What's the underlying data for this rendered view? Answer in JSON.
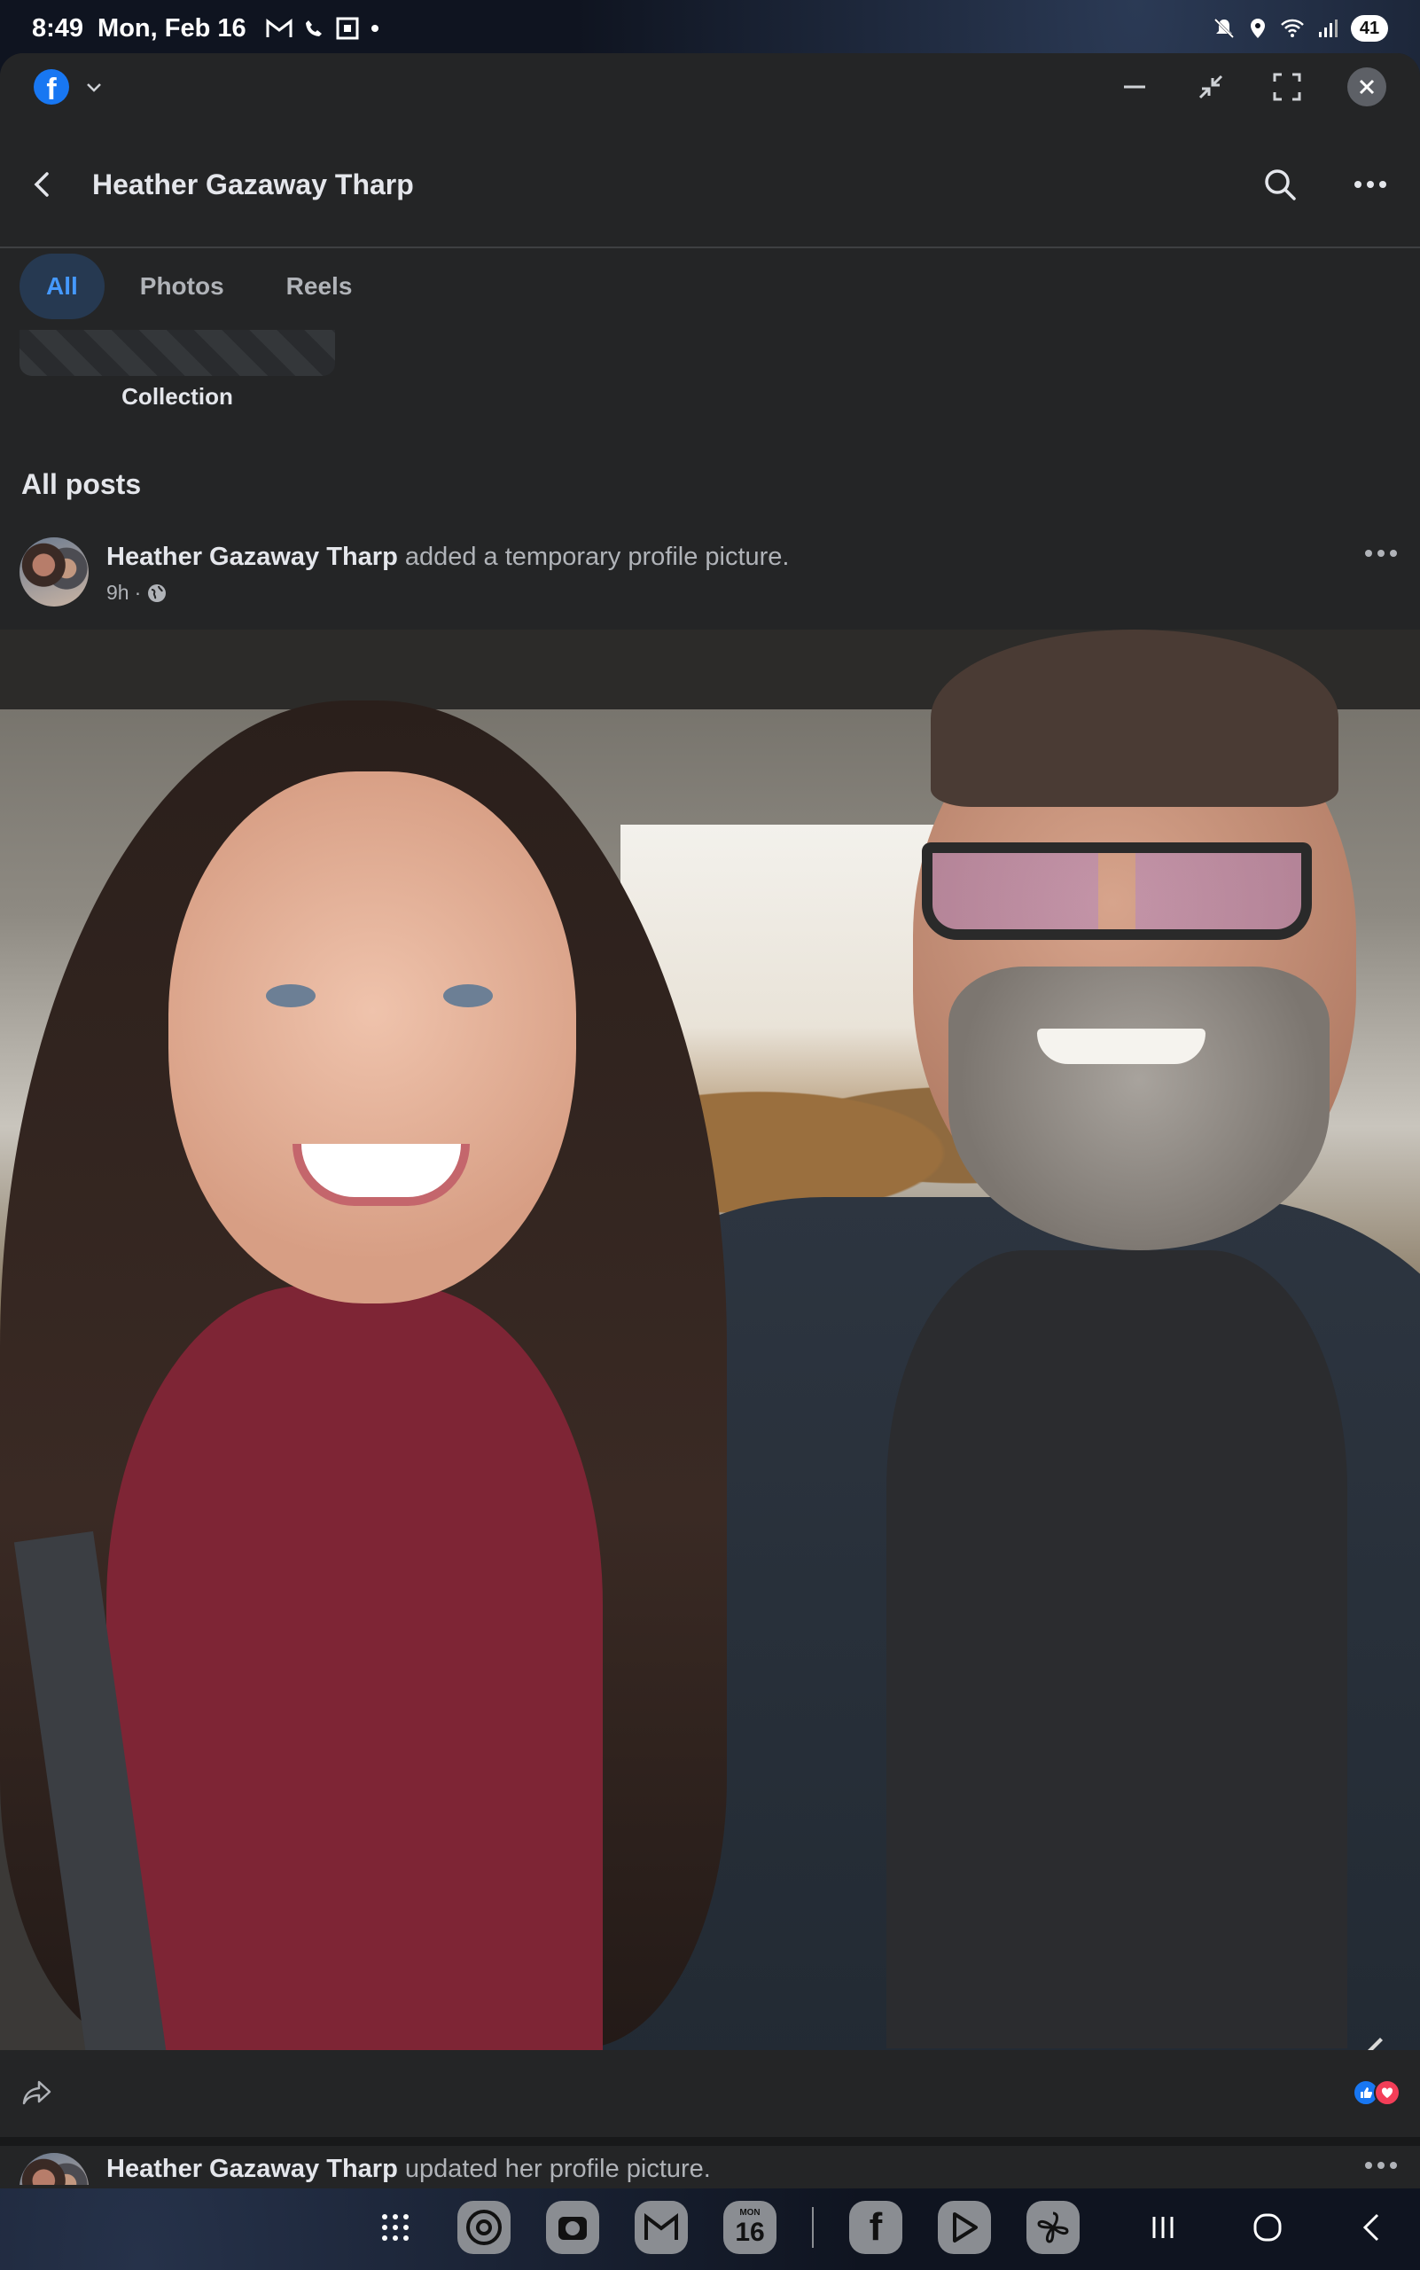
{
  "status_bar": {
    "time": "8:49",
    "date": "Mon, Feb 16",
    "battery": "41"
  },
  "window": {
    "app_icon": "facebook-icon"
  },
  "header": {
    "title": "Heather Gazaway Tharp"
  },
  "tabs": [
    {
      "label": "All",
      "active": true
    },
    {
      "label": "Photos",
      "active": false
    },
    {
      "label": "Reels",
      "active": false
    }
  ],
  "collection": {
    "label": "Collection"
  },
  "section": {
    "title": "All posts"
  },
  "posts": [
    {
      "author": "Heather Gazaway Tharp",
      "action": "added a temporary profile picture.",
      "time": "9h",
      "separator": "·",
      "privacy_icon": "globe-icon"
    },
    {
      "author": "Heather Gazaway Tharp",
      "action": "updated her profile picture."
    }
  ],
  "dock": {
    "calendar_day": "16",
    "calendar_weekday": "MON"
  },
  "colors": {
    "accent": "#1877f2",
    "tab_active_text": "#4599ff",
    "tab_active_bg": "#263951",
    "surface": "#242526",
    "love": "#f33e58"
  }
}
